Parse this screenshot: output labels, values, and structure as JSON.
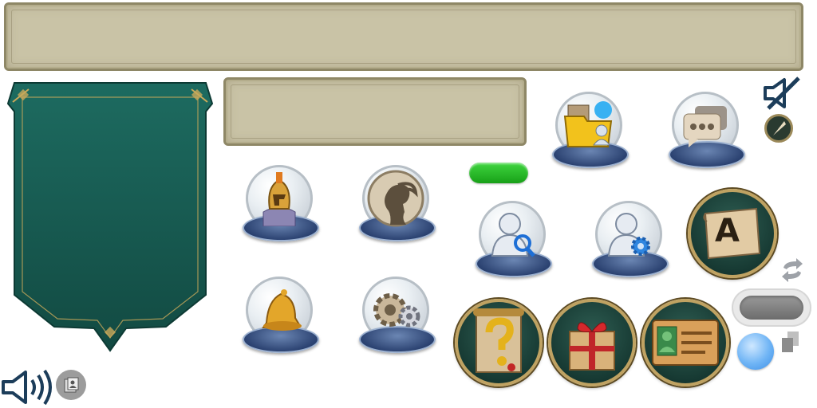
{
  "text_button": {
    "label": "A"
  },
  "colors": {
    "teal_panel": "#17584e",
    "parchment": "#c9c3a6",
    "green_bar": "#22b322",
    "icon_navy": "#1c3d5a",
    "gold": "#bfa262"
  },
  "icons": [
    "helmet-icon",
    "profile-head-icon",
    "bell-icon",
    "gears-icon",
    "folder-user-icon",
    "chat-icon",
    "user-search-icon",
    "user-settings-icon",
    "scroll-text-icon",
    "quest-scroll-icon",
    "gift-icon",
    "id-card-icon",
    "mute-icon",
    "quill-icon",
    "sound-icon",
    "photo-icon",
    "swap-icon",
    "copy-icon"
  ]
}
